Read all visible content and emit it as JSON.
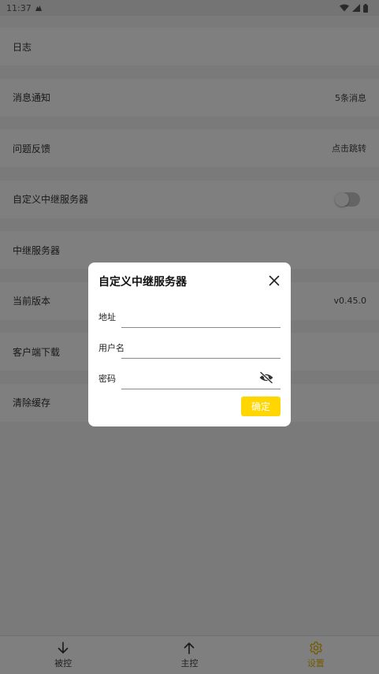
{
  "status_bar": {
    "time": "11:37"
  },
  "settings": {
    "logs": {
      "label": "日志"
    },
    "notifications": {
      "label": "消息通知",
      "value": "5条消息"
    },
    "feedback": {
      "label": "问题反馈",
      "value": "点击跳转"
    },
    "custom_relay": {
      "label": "自定义中继服务器",
      "enabled": false
    },
    "relay_server": {
      "label": "中继服务器"
    },
    "version": {
      "label": "当前版本",
      "value": "v0.45.0"
    },
    "client_download": {
      "label": "客户端下载"
    },
    "clear_cache": {
      "label": "清除缓存"
    }
  },
  "bottom_nav": {
    "items": [
      {
        "label": "被控",
        "icon": "arrow-down-icon",
        "active": false
      },
      {
        "label": "主控",
        "icon": "arrow-up-icon",
        "active": false
      },
      {
        "label": "设置",
        "icon": "gear-icon",
        "active": true
      }
    ]
  },
  "dialog": {
    "title": "自定义中继服务器",
    "address": {
      "label": "地址",
      "value": ""
    },
    "username": {
      "label": "用户名",
      "value": ""
    },
    "password": {
      "label": "密码",
      "value": ""
    },
    "confirm_label": "确定"
  },
  "colors": {
    "accent": "#ffd600",
    "active_nav": "#e6b800"
  }
}
